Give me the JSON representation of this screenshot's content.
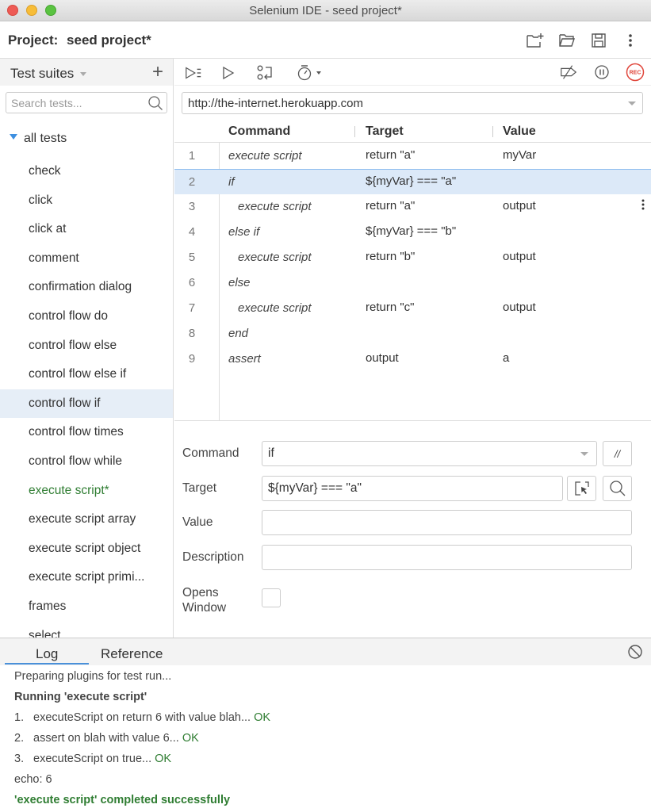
{
  "window": {
    "title": "Selenium IDE - seed project*"
  },
  "project": {
    "label": "Project:",
    "name": "seed project*",
    "icons": [
      "new-project-icon",
      "open-project-icon",
      "save-project-icon",
      "more-icon"
    ]
  },
  "sidebar": {
    "header": "Test suites",
    "add_label": "+",
    "search_placeholder": "Search tests...",
    "search_value": "",
    "root": "all tests",
    "tests": [
      {
        "label": "check",
        "state": "normal"
      },
      {
        "label": "click",
        "state": "normal"
      },
      {
        "label": "click at",
        "state": "normal"
      },
      {
        "label": "comment",
        "state": "normal"
      },
      {
        "label": "confirmation dialog",
        "state": "normal"
      },
      {
        "label": "control flow do",
        "state": "normal"
      },
      {
        "label": "control flow else",
        "state": "normal"
      },
      {
        "label": "control flow else if",
        "state": "normal"
      },
      {
        "label": "control flow if",
        "state": "selected"
      },
      {
        "label": "control flow times",
        "state": "normal"
      },
      {
        "label": "control flow while",
        "state": "normal"
      },
      {
        "label": "execute script*",
        "state": "modified"
      },
      {
        "label": "execute script array",
        "state": "normal"
      },
      {
        "label": "execute script object",
        "state": "normal"
      },
      {
        "label": "execute script primi...",
        "state": "normal"
      },
      {
        "label": "frames",
        "state": "normal"
      },
      {
        "label": "select",
        "state": "normal"
      }
    ]
  },
  "toolbar": {
    "left_icons": [
      "run-all-tests-icon",
      "run-test-icon",
      "step-over-icon",
      "speed-timer-icon"
    ],
    "right_icons": [
      "disable-breakpoints-icon",
      "pause-icon",
      "record-icon"
    ],
    "record_label": "REC"
  },
  "url": {
    "value": "http://the-internet.herokuapp.com"
  },
  "table": {
    "headers": {
      "command": "Command",
      "target": "Target",
      "value": "Value"
    },
    "rows": [
      {
        "num": "1",
        "command": "execute script",
        "target": "return \"a\"",
        "value": "myVar",
        "indent": false,
        "selected": false
      },
      {
        "num": "2",
        "command": "if",
        "target": "${myVar} === \"a\"",
        "value": "",
        "indent": false,
        "selected": true
      },
      {
        "num": "3",
        "command": "execute script",
        "target": "return \"a\"",
        "value": "output",
        "indent": true,
        "selected": false
      },
      {
        "num": "4",
        "command": "else if",
        "target": "${myVar} === \"b\"",
        "value": "",
        "indent": false,
        "selected": false
      },
      {
        "num": "5",
        "command": "execute script",
        "target": "return \"b\"",
        "value": "output",
        "indent": true,
        "selected": false
      },
      {
        "num": "6",
        "command": "else",
        "target": "",
        "value": "",
        "indent": false,
        "selected": false
      },
      {
        "num": "7",
        "command": "execute script",
        "target": "return \"c\"",
        "value": "output",
        "indent": true,
        "selected": false
      },
      {
        "num": "8",
        "command": "end",
        "target": "",
        "value": "",
        "indent": false,
        "selected": false
      },
      {
        "num": "9",
        "command": "assert",
        "target": "output",
        "value": "a",
        "indent": false,
        "selected": false
      }
    ]
  },
  "details": {
    "command_label": "Command",
    "command_value": "if",
    "comment_button": "//",
    "target_label": "Target",
    "target_value": "${myVar} === \"a\"",
    "value_label": "Value",
    "value_value": "",
    "description_label": "Description",
    "description_value": "",
    "opens_window_label_1": "Opens",
    "opens_window_label_2": "Window",
    "opens_window_checked": false
  },
  "console": {
    "tabs": [
      "Log",
      "Reference"
    ],
    "active_tab": "Log",
    "lines": {
      "preparing": "Preparing plugins for test run...",
      "running": "Running 'execute script'",
      "step1_idx": "1.",
      "step1": "executeScript on return 6 with value blah...",
      "step2_idx": "2.",
      "step2": "assert on blah with value 6...",
      "step3_idx": "3.",
      "step3": "executeScript on true...",
      "ok": "OK",
      "echo": "echo: 6",
      "completed": "'execute script' completed successfully"
    }
  },
  "colors": {
    "accent": "#4a90d9",
    "success": "#2f7d32",
    "record": "#e0453a",
    "selected_row": "#dce9f8"
  }
}
